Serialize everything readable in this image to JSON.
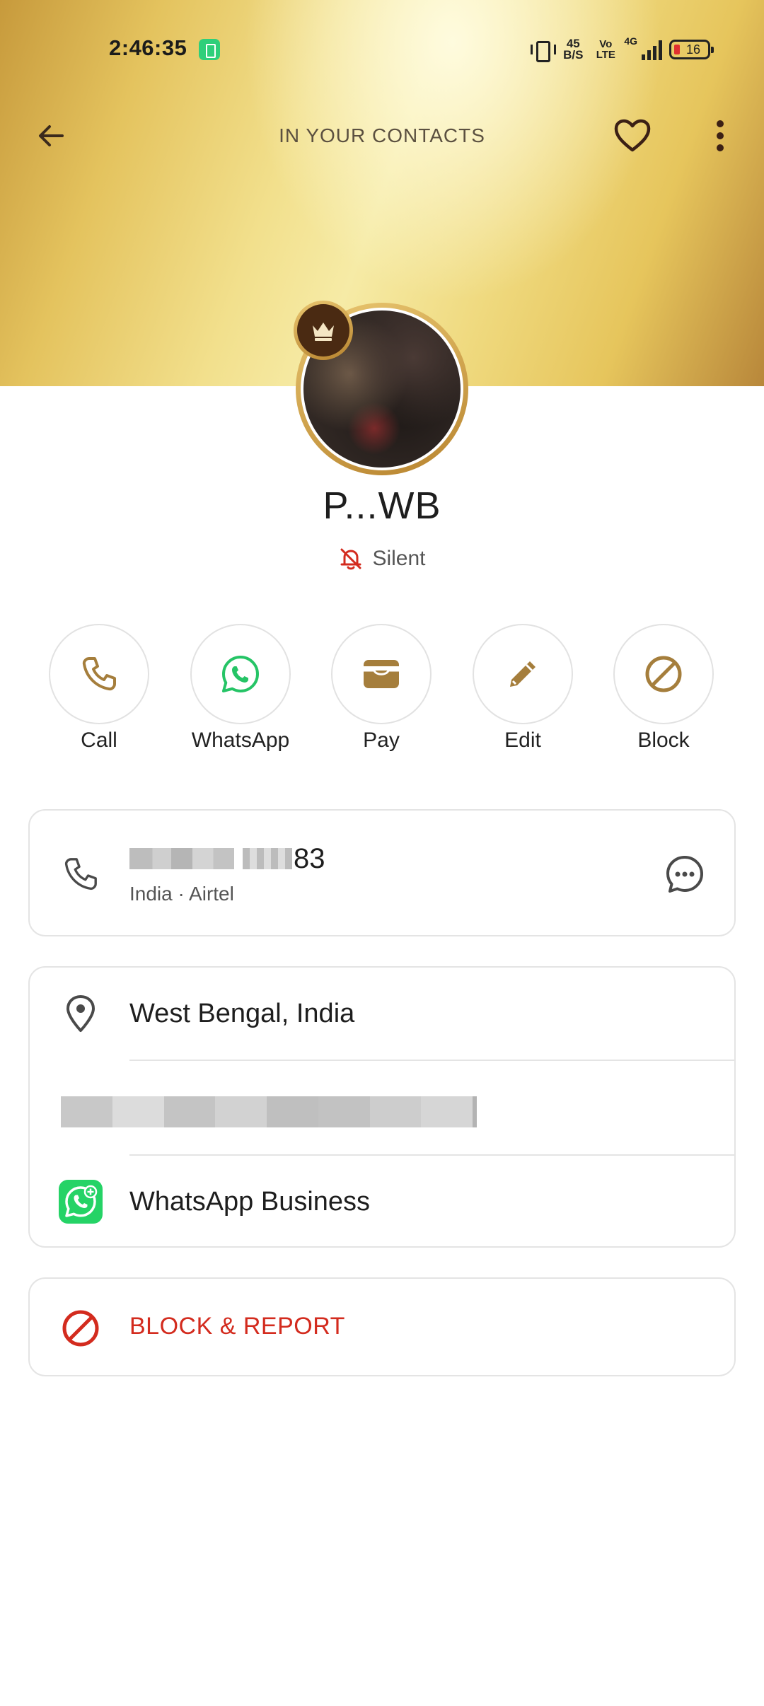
{
  "status_bar": {
    "time": "2:46:35",
    "network_speed_top": "45",
    "network_speed_bottom": "B/S",
    "volte_top": "Vo",
    "volte_bottom": "LTE",
    "network_type": "4G",
    "battery": "16"
  },
  "top_bar": {
    "title": "IN YOUR CONTACTS"
  },
  "contact": {
    "name": "P...WB",
    "ringtone_status": "Silent"
  },
  "actions": [
    {
      "label": "Call",
      "icon": "phone-icon"
    },
    {
      "label": "WhatsApp",
      "icon": "whatsapp-icon"
    },
    {
      "label": "Pay",
      "icon": "wallet-icon"
    },
    {
      "label": "Edit",
      "icon": "pencil-icon"
    },
    {
      "label": "Block",
      "icon": "block-icon"
    }
  ],
  "phone": {
    "number_visible_suffix": "83",
    "subtitle": "India · Airtel"
  },
  "details": {
    "location": "West Bengal, India",
    "linked_app": "WhatsApp Business"
  },
  "block_report": {
    "label": "BLOCK & REPORT"
  },
  "colors": {
    "accent_gold": "#a57e3c",
    "danger_red": "#d32b1e",
    "whatsapp_green": "#25d366"
  }
}
